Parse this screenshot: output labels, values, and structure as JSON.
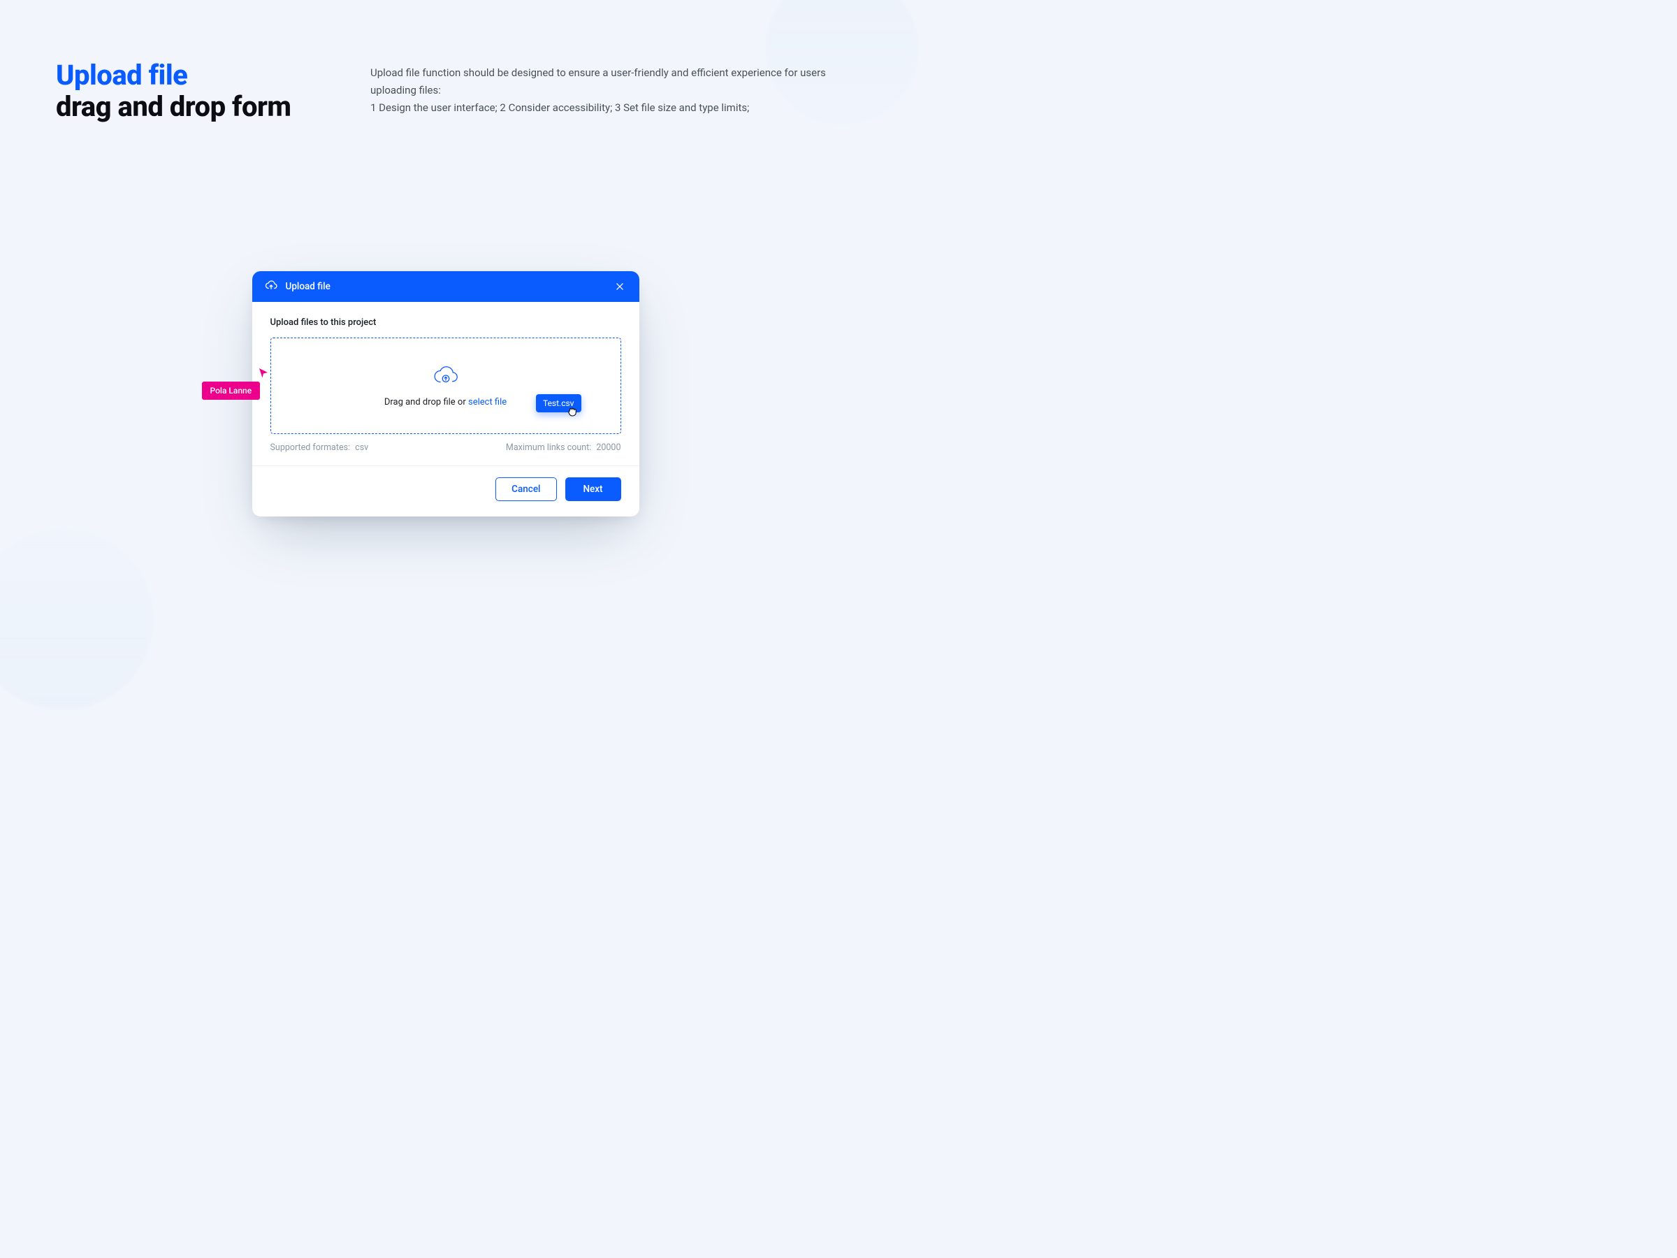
{
  "header": {
    "title_line1": "Upload file",
    "title_line2": "drag and drop form",
    "description": "Upload file function should be designed to ensure a user-friendly and efficient experience for users uploading files:\n1 Design the user interface; 2 Consider accessibility; 3 Set file size and type limits;"
  },
  "modal": {
    "title": "Upload file",
    "section_label": "Upload files to this project",
    "drop_prompt_prefix": "Drag and drop file or ",
    "drop_prompt_link": "select file",
    "file_chip": "Test.csv",
    "supported_label": "Supported formates:",
    "supported_value": "csv",
    "max_label": "Maximum links count:",
    "max_value": "20000",
    "cancel_label": "Cancel",
    "next_label": "Next"
  },
  "collab_cursor": {
    "user": "Pola Lanne"
  },
  "colors": {
    "primary": "#0b5cff",
    "magenta": "#ec008c",
    "bg": "#f2f6fc"
  }
}
